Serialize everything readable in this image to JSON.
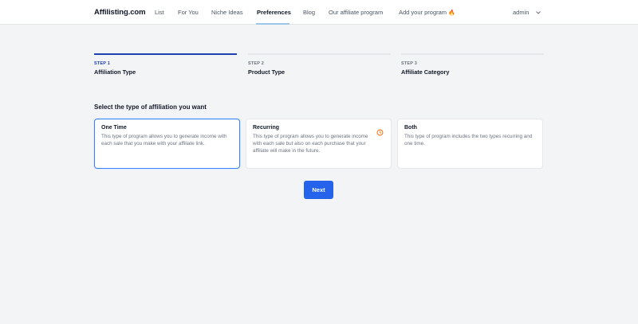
{
  "brand": "Affilisting.com",
  "nav": {
    "items": [
      {
        "label": "List"
      },
      {
        "label": "For You"
      },
      {
        "label": "Niche Ideas"
      },
      {
        "label": "Preferences"
      },
      {
        "label": "Blog"
      },
      {
        "label": "Our affiliate program"
      },
      {
        "label": "Add your program"
      }
    ],
    "active": "Preferences",
    "add_program_badge": "🔥",
    "user": "admin"
  },
  "steps": [
    {
      "number": "STEP 1",
      "name": "Affiliation Type",
      "status": "current"
    },
    {
      "number": "STEP 2",
      "name": "Product Type",
      "status": "upcoming"
    },
    {
      "number": "STEP 3",
      "name": "Affiliate Category",
      "status": "upcoming"
    }
  ],
  "question": "Select the type of affiliation you want",
  "options": [
    {
      "title": "One Time",
      "description": "This type of program allows you to generate income with each sale that you make with your affiliate link.",
      "selected": true
    },
    {
      "title": "Recurring",
      "description": "This type of program allows you to generate income with each sale but also on each purchase that your affiliate will make in the future.",
      "icon": "recurring-icon",
      "selected": false
    },
    {
      "title": "Both",
      "description": "This type of program includes the two types recurring and one time.",
      "selected": false
    }
  ],
  "next_label": "Next",
  "colors": {
    "primary": "#2563eb",
    "step_active": "#1e40af",
    "recurring_icon": "#f97316"
  }
}
